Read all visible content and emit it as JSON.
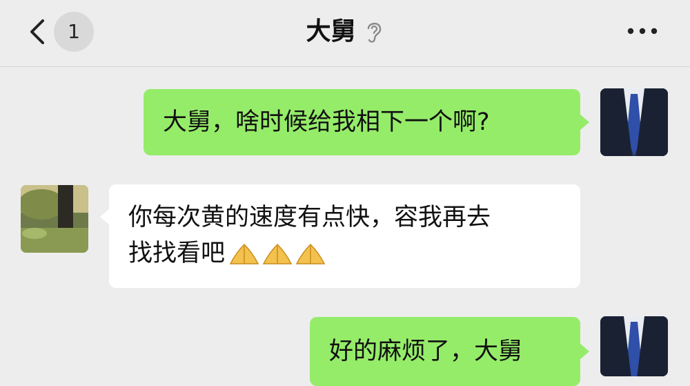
{
  "header": {
    "unread_count": "1",
    "title": "大舅",
    "icons": {
      "back": "chevron-left-icon",
      "mute": "ear-icon",
      "more": "more-dots-icon"
    }
  },
  "messages": [
    {
      "sender": "me",
      "text": "大舅，啥时候给我相下一个啊?"
    },
    {
      "sender": "contact",
      "line1": "你每次黄的速度有点快，容我再去",
      "line2": "找找看吧",
      "emoji_count": 3,
      "emoji": "pray-hands-icon"
    },
    {
      "sender": "me",
      "text": "好的麻烦了，大舅"
    }
  ],
  "colors": {
    "background": "#ededed",
    "my_bubble": "#95ec69",
    "their_bubble": "#ffffff"
  }
}
